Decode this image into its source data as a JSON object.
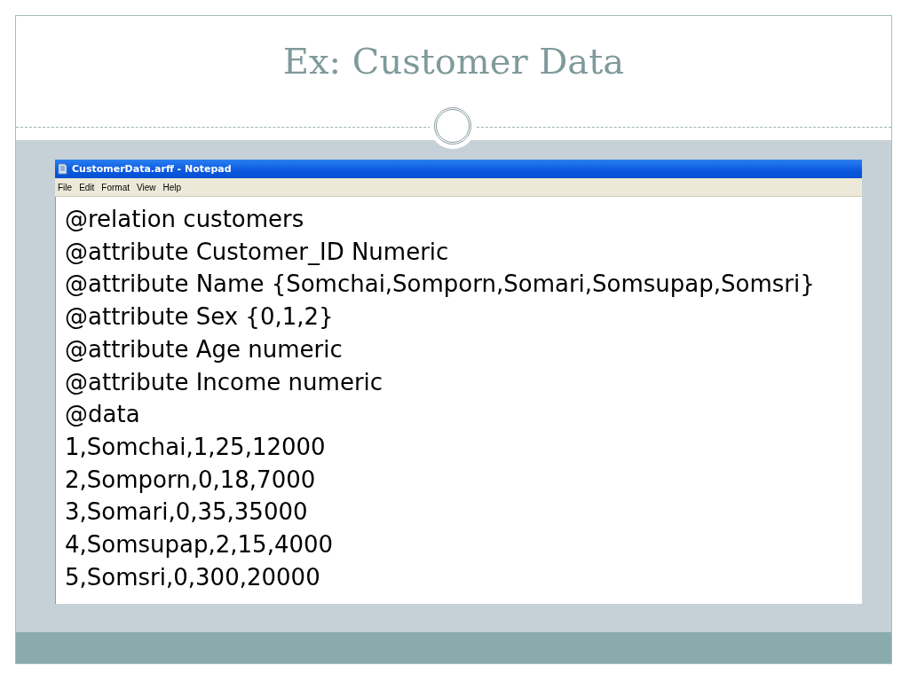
{
  "slide": {
    "title": "Ex: Customer Data"
  },
  "notepad": {
    "title": "CustomerData.arff - Notepad",
    "menu": [
      "File",
      "Edit",
      "Format",
      "View",
      "Help"
    ],
    "lines": [
      "@relation customers",
      "@attribute Customer_ID Numeric",
      "@attribute Name {Somchai,Somporn,Somari,Somsupap,Somsri}",
      "@attribute Sex {0,1,2}",
      "@attribute Age numeric",
      "@attribute Income numeric",
      "@data",
      "1,Somchai,1,25,12000",
      "2,Somporn,0,18,7000",
      "3,Somari,0,35,35000",
      "4,Somsupap,2,15,4000",
      "5,Somsri,0,300,20000"
    ]
  }
}
